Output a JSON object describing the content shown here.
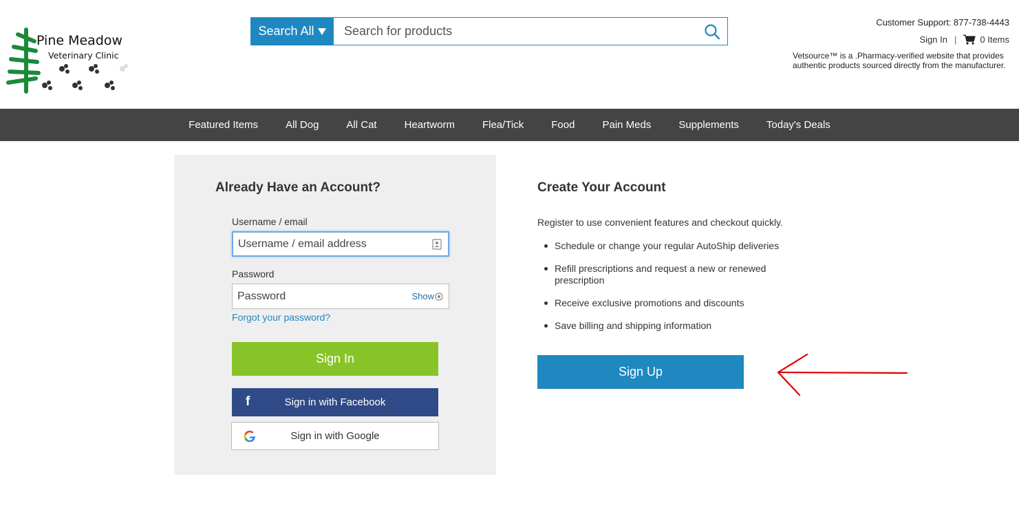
{
  "brand": {
    "name": "Pine Meadow",
    "subtitle": "Veterinary Clinic"
  },
  "search": {
    "category_label": "Search All",
    "placeholder": "Search for products"
  },
  "header": {
    "support": "Customer Support: 877-738-4443",
    "sign_in": "Sign In",
    "separator": "|",
    "cart_label": "0 Items",
    "verification": "Vetsource™ is a .Pharmacy-verified website that provides authentic products sourced directly from the manufacturer."
  },
  "nav": {
    "items": [
      "Featured Items",
      "All Dog",
      "All Cat",
      "Heartworm",
      "Flea/Tick",
      "Food",
      "Pain Meds",
      "Supplements",
      "Today's Deals"
    ]
  },
  "signin": {
    "title": "Already Have an Account?",
    "username_label": "Username / email",
    "username_placeholder": "Username / email address",
    "password_label": "Password",
    "password_placeholder": "Password",
    "show_label": "Show",
    "forgot_label": "Forgot your password?",
    "signin_button": "Sign In",
    "facebook_icon": "f",
    "facebook_button": "Sign in with Facebook",
    "google_button": "Sign in with Google"
  },
  "create": {
    "title": "Create Your Account",
    "description": "Register to use convenient features and checkout quickly.",
    "benefits": [
      "Schedule or change your regular AutoShip deliveries",
      "Refill prescriptions and request a new or renewed prescription",
      "Receive exclusive promotions and discounts",
      "Save billing and shipping information"
    ],
    "signup_button": "Sign Up"
  },
  "colors": {
    "accent": "#1f88c1",
    "nav_bg": "#444444",
    "signin_green": "#88c428",
    "facebook_blue": "#2f4a87",
    "arrow_red": "#e00000"
  },
  "icons": {
    "search": "search-icon",
    "cart": "cart-icon",
    "dropdown": "triangle-down-icon",
    "contact_card": "contact-card-icon",
    "eye": "eye-icon",
    "facebook": "facebook-icon",
    "google": "google-icon",
    "annotation": "red-arrow-icon"
  }
}
